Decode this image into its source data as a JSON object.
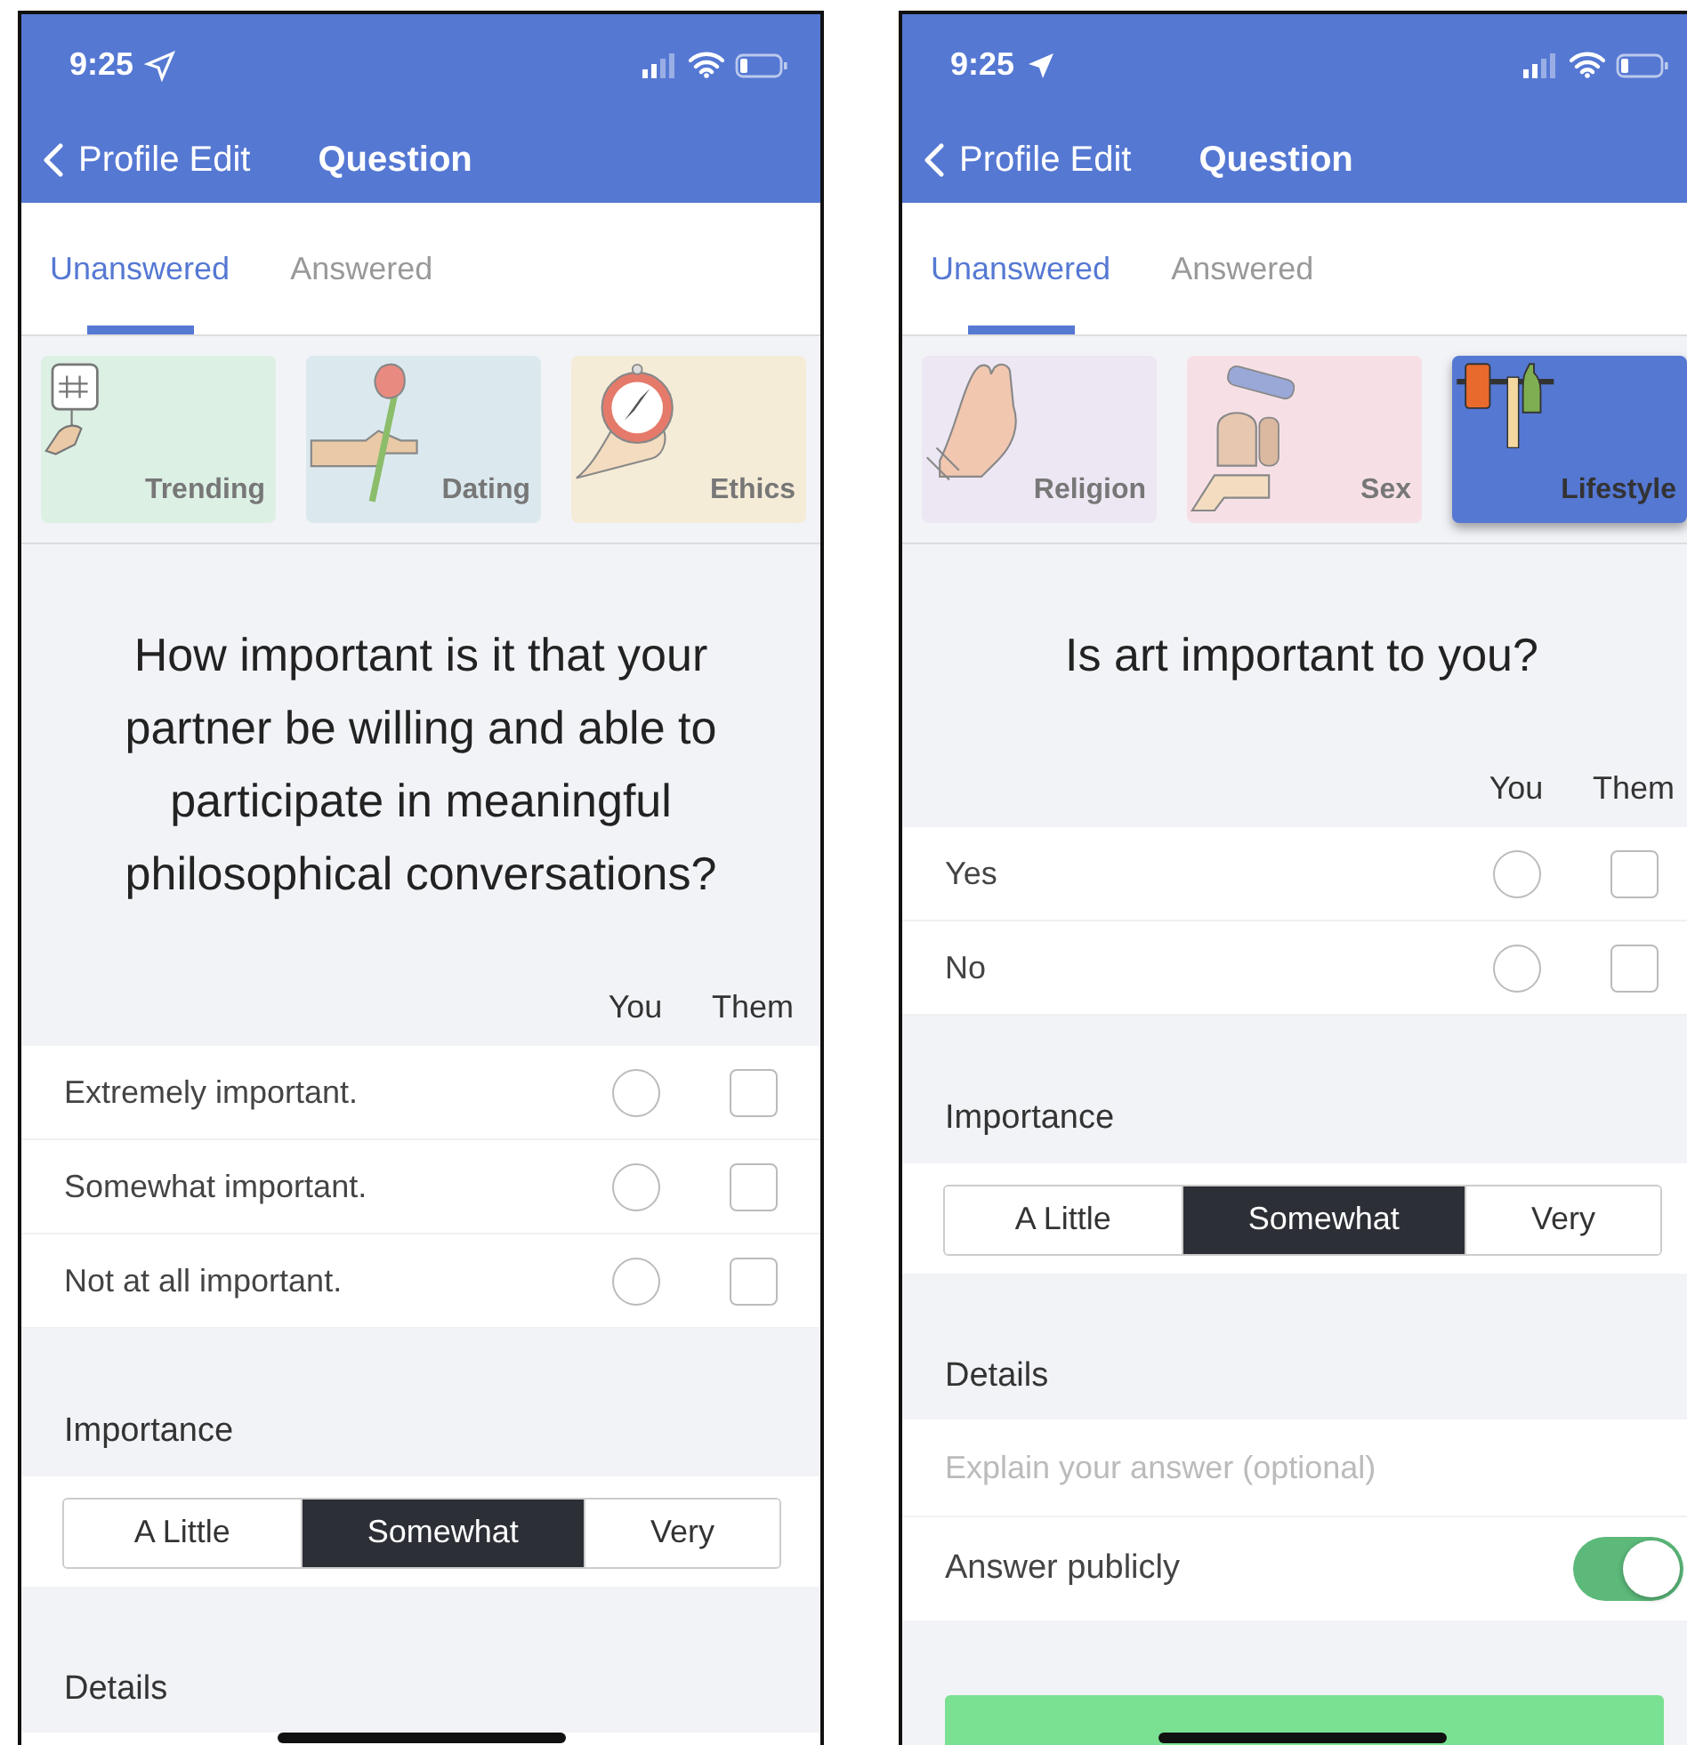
{
  "phones": [
    {
      "status_time": "9:25",
      "location": {
        "kind": "outline"
      },
      "back_label": "Profile Edit",
      "title": "Question",
      "tabs": [
        {
          "label": "Unanswered",
          "selected": true
        },
        {
          "label": "Answered",
          "selected": false
        }
      ],
      "categories": [
        {
          "label": "Trending",
          "kind": "hashtag",
          "color": "#dcf0e4",
          "selected": false
        },
        {
          "label": "Dating",
          "kind": "rose",
          "color": "#dbe9ef",
          "selected": false
        },
        {
          "label": "Ethics",
          "kind": "compass",
          "color": "#f5ecd8",
          "selected": false
        }
      ],
      "question": "How important is it that your partner be willing and able to participate in meaningful philosophical conversations?",
      "columns": [
        "You",
        "Them"
      ],
      "options": [
        {
          "label": "Extremely important.",
          "you_selected": false,
          "them_checked": false
        },
        {
          "label": "Somewhat important.",
          "you_selected": false,
          "them_checked": false
        },
        {
          "label": "Not at all important.",
          "you_selected": false,
          "them_checked": false
        }
      ],
      "importance_label": "Importance",
      "importance": [
        {
          "label": "A Little",
          "selected": false
        },
        {
          "label": "Somewhat",
          "selected": true
        },
        {
          "label": "Very",
          "selected": false
        }
      ],
      "details_label": "Details"
    },
    {
      "status_time": "9:25",
      "location": {
        "kind": "filled"
      },
      "back_label": "Profile Edit",
      "title": "Question",
      "tabs": [
        {
          "label": "Unanswered",
          "selected": true
        },
        {
          "label": "Answered",
          "selected": false
        }
      ],
      "categories": [
        {
          "label": "Religion",
          "kind": "hands",
          "color": "#ede6f3",
          "selected": false
        },
        {
          "label": "Sex",
          "kind": "bell",
          "color": "#f6e0e6",
          "selected": false
        },
        {
          "label": "Lifestyle",
          "kind": "barbell",
          "color": "#5578d3",
          "selected": true
        }
      ],
      "question": "Is art important to you?",
      "columns": [
        "You",
        "Them"
      ],
      "options": [
        {
          "label": "Yes",
          "you_selected": false,
          "them_checked": false
        },
        {
          "label": "No",
          "you_selected": false,
          "them_checked": false
        }
      ],
      "importance_label": "Importance",
      "importance": [
        {
          "label": "A Little",
          "selected": false
        },
        {
          "label": "Somewhat",
          "selected": true
        },
        {
          "label": "Very",
          "selected": false
        }
      ],
      "details_label": "Details",
      "details_placeholder": "Explain your answer (optional)",
      "answer_publicly": {
        "label": "Answer publicly",
        "on": true
      },
      "answer_button": true
    }
  ]
}
